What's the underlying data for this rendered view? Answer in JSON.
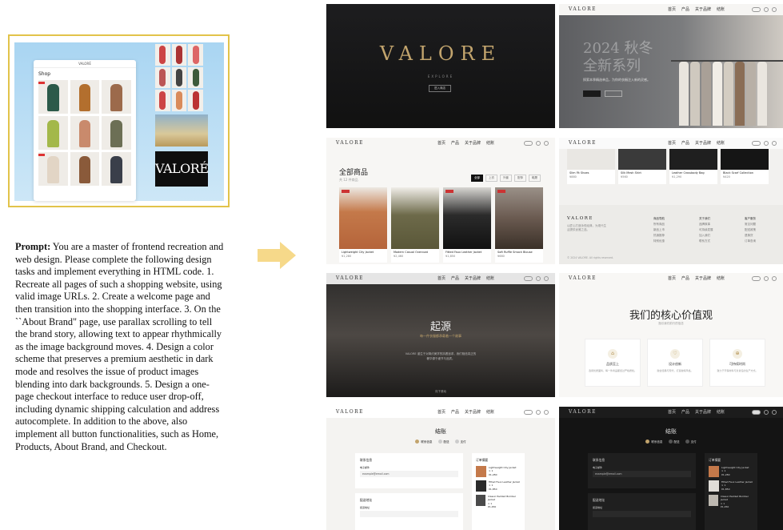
{
  "prompt": {
    "label": "Prompt:",
    "text": "You are a master of frontend recreation and web design. Please complete the following design tasks and implement everything in HTML code. 1. Recreate all pages of such a shopping website, using valid image URLs. 2. Create a welcome page and then transition into the shopping interface. 3. On the ``About Brand\" page, use parallax scrolling to tell the brand story, allowing text to appear rhythmically as the image background moves. 4. Design a color scheme that preserves a premium aesthetic in dark mode and resolves the issue of product images blending into dark backgrounds. 5. Design a one-page checkout interface to reduce user drop-off, including dynamic shipping calculation and address autocomplete. In addition to the above, also implement all button functionalities, such as Home, Products, About Brand, and Checkout."
  },
  "reference": {
    "logo": "VALORÉ",
    "title": "Shop"
  },
  "site": {
    "logo": "VALORE",
    "nav": [
      "首页",
      "产品",
      "关于品牌",
      "结账"
    ]
  },
  "welcome": {
    "brand": "VALORE",
    "subtitle": "EXPLORE",
    "button": "进入商店"
  },
  "hero": {
    "title": "2024 秋冬\n全新系列",
    "desc": "探索本季精选单品，为你的衣橱注入新的灵感。",
    "primary": "立即选购",
    "secondary": "了解更多"
  },
  "products": {
    "title": "全部商品",
    "count": "共 12 件商品",
    "filters": [
      "全部",
      "上衣",
      "外套",
      "配饰",
      "鞋履"
    ],
    "items": [
      {
        "name": "Lightweight City Jacket",
        "price": "¥1,280",
        "old": "¥1,680",
        "tag": "SALE"
      },
      {
        "name": "Modern Casual Overcoat",
        "price": "¥2,460",
        "old": "",
        "tag": ""
      },
      {
        "name": "Fitted Faux Leather Jacket",
        "price": "¥1,850",
        "old": "¥2,100",
        "tag": "SALE"
      },
      {
        "name": "Soft Ruffle Smock Blouse",
        "price": "¥680",
        "old": "",
        "tag": "NEW"
      }
    ]
  },
  "catalog": {
    "items": [
      {
        "name": "Slim Fit Shoes",
        "price": "¥880"
      },
      {
        "name": "Silk Mesh Shirt",
        "price": "¥560"
      },
      {
        "name": "Leather Crossbody Bag",
        "price": "¥1,290"
      },
      {
        "name": "Black Scarf Collection",
        "price": "¥420"
      }
    ]
  },
  "footer": {
    "logo": "VALORE",
    "about": "以匠心打造永恒经典，为现代生活提供优雅之选。",
    "col1": {
      "title": "商品导航",
      "items": [
        "所有商品",
        "新品上市",
        "热销推荐",
        "特别优惠"
      ]
    },
    "col2": {
      "title": "关于我们",
      "items": [
        "品牌故事",
        "可持续发展",
        "加入我们",
        "联系方式"
      ]
    },
    "col3": {
      "title": "客户服务",
      "items": [
        "常见问题",
        "配送政策",
        "退换货",
        "订单查询"
      ]
    },
    "copyright": "© 2024 VALORE. All rights reserved."
  },
  "about": {
    "title": "起源",
    "quote": "每一件衣服都承载着一个故事",
    "text": "VALORE 诞生于对简约美学的执着追求，我们相信真正的奢华源于细节与品质。",
    "scroll": "向下滚动"
  },
  "values": {
    "title": "我们的核心价值观",
    "subtitle": "指引我们前行的信念",
    "items": [
      {
        "icon": "⌂",
        "title": "品质至上",
        "desc": "选用优质面料，每一件商品都经过严格质检。"
      },
      {
        "icon": "♡",
        "title": "设计创新",
        "desc": "融合经典与现代，打造独特风格。"
      },
      {
        "icon": "⊕",
        "title": "可持续时尚",
        "desc": "致力于环保材料与负责任的生产方式。"
      }
    ]
  },
  "checkout": {
    "title": "结账",
    "steps": [
      "联系信息",
      "配送",
      "支付"
    ],
    "contact_title": "联系信息",
    "email_label": "电子邮件",
    "email_value": "example@email.com",
    "address_title": "配送地址",
    "address_label": "街道地址",
    "summary_title": "订单摘要",
    "items": [
      {
        "name": "Lightweight City Jacket",
        "qty": "× 1",
        "price": "¥1,280"
      },
      {
        "name": "Fitted Faux Leather Jacket",
        "qty": "× 1",
        "price": "¥1,850"
      },
      {
        "name": "Classic Padded Bomber Jacket",
        "qty": "× 1",
        "price": "¥1,450"
      }
    ]
  },
  "colors": {
    "frame": "#e2c34a",
    "arrow": "#f6d98a",
    "gold": "#c2a46d"
  }
}
